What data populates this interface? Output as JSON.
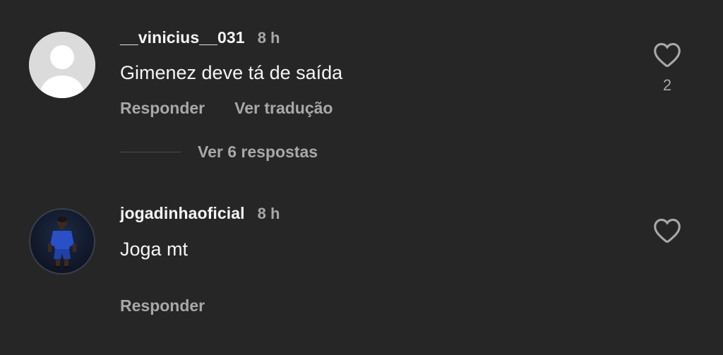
{
  "comments": [
    {
      "username": "__vinicius__031",
      "time": "8 h",
      "text": "Gimenez deve tá de saída",
      "like_count": "2",
      "actions": {
        "reply": "Responder",
        "translate": "Ver tradução"
      },
      "view_replies": "Ver 6 respostas"
    },
    {
      "username": "jogadinhaoficial",
      "time": "8 h",
      "text": "Joga mt",
      "actions": {
        "reply": "Responder"
      }
    }
  ],
  "colors": {
    "background": "#262626",
    "primary_text": "#f5f5f5",
    "secondary_text": "#a8a8a8"
  }
}
